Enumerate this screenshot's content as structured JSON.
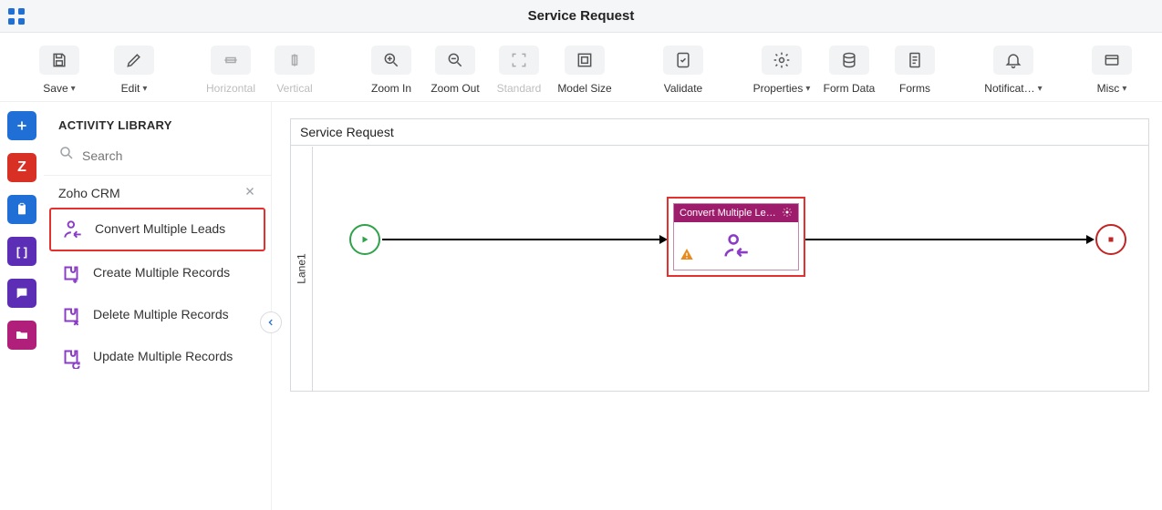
{
  "header": {
    "title": "Service Request"
  },
  "toolbar": {
    "save": "Save",
    "edit": "Edit",
    "horizontal": "Horizontal",
    "vertical": "Vertical",
    "zoom_in": "Zoom In",
    "zoom_out": "Zoom Out",
    "standard": "Standard",
    "model_size": "Model Size",
    "validate": "Validate",
    "properties": "Properties",
    "form_data": "Form Data",
    "forms": "Forms",
    "notifications": "Notificat…",
    "misc": "Misc"
  },
  "sidebar": {
    "title": "ACTIVITY LIBRARY",
    "search_placeholder": "Search",
    "group": "Zoho CRM",
    "items": [
      {
        "label": "Convert Multiple Leads"
      },
      {
        "label": "Create Multiple Records"
      },
      {
        "label": "Delete Multiple Records"
      },
      {
        "label": "Update Multiple Records"
      }
    ]
  },
  "canvas": {
    "title": "Service Request",
    "lane": "Lane1",
    "activity_label": "Convert Multiple Lea..."
  }
}
